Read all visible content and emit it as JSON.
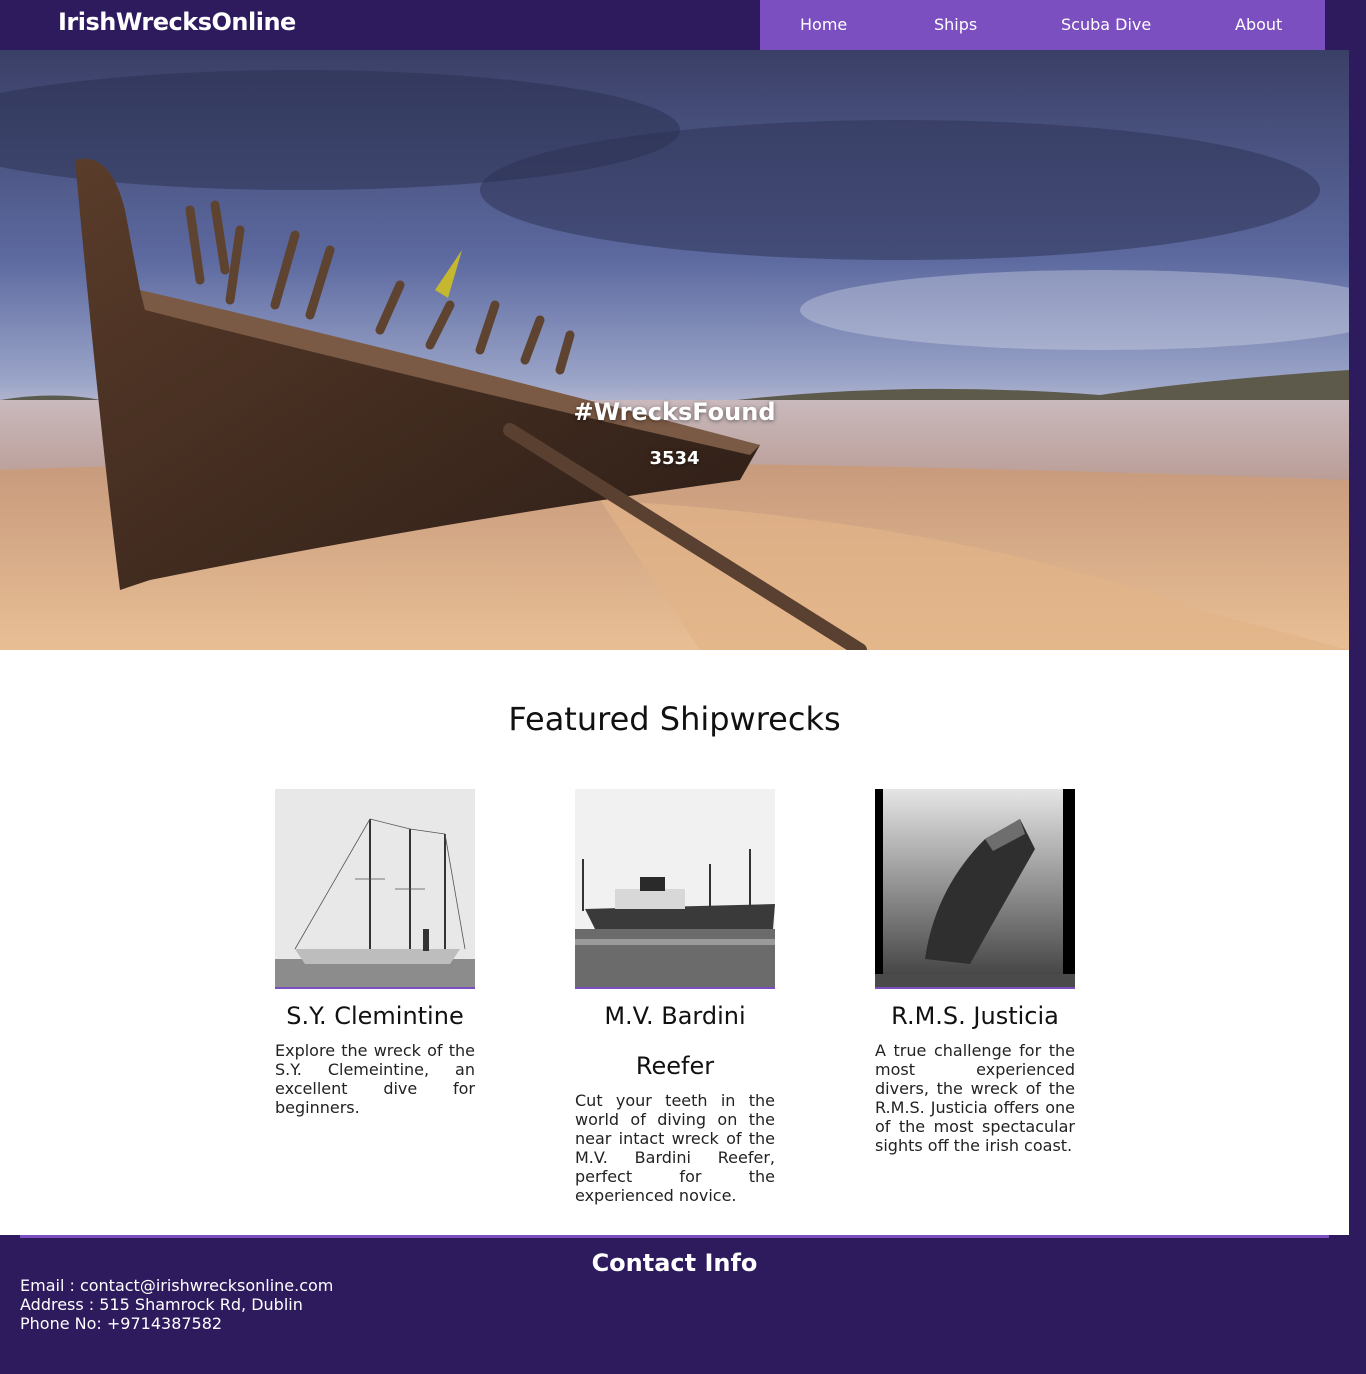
{
  "brand": "IrishWrecksOnline",
  "nav": {
    "items": [
      "Home",
      "Ships",
      "Scuba Dive",
      "About"
    ]
  },
  "hero": {
    "heading": "#WrecksFound",
    "count": "3534"
  },
  "featured": {
    "title": "Featured Shipwrecks",
    "cards": [
      {
        "title": "S.Y. Clemintine",
        "description": "Explore the wreck of the S.Y. Clemeintine, an excellent dive for beginners."
      },
      {
        "title": "M.V. Bardini Reefer",
        "description": "Cut your teeth in the world of diving on the near intact wreck of the M.V. Bardini Reefer, perfect for the experienced novice."
      },
      {
        "title": "R.M.S. Justicia",
        "description": "A true challenge for the most experienced divers, the wreck of the R.M.S. Justicia offers one of the most spectacular sights off the irish coast."
      }
    ]
  },
  "footer": {
    "title": "Contact Info",
    "email": "Email : contact@irishwrecksonline.com",
    "address": "Address : 515 Shamrock Rd, Dublin",
    "phone": "Phone No: +9714387582"
  },
  "colors": {
    "navbar_bg": "#2e1b5e",
    "nav_links_bg": "#7c4fc0",
    "accent": "#7c4fc0"
  }
}
